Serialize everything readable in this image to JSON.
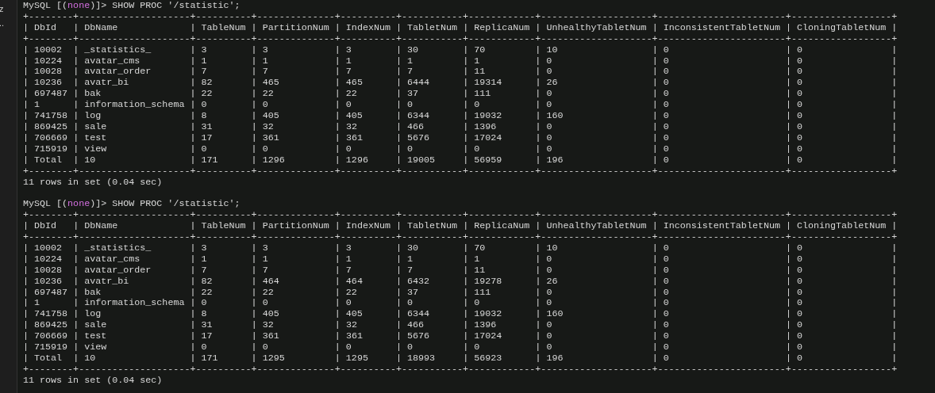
{
  "sidebar": {
    "items": [
      "z",
      ".."
    ]
  },
  "frame": {
    "bar": "|"
  },
  "blocks": [
    {
      "prompt": {
        "before": "MySQL [(",
        "database": "none",
        "after": ")]> SHOW PROC '/statistic';"
      },
      "columns": [
        "DbId",
        "DbName",
        "TableNum",
        "PartitionNum",
        "IndexNum",
        "TabletNum",
        "ReplicaNum",
        "UnhealthyTabletNum",
        "InconsistentTabletNum",
        "CloningTabletNum"
      ],
      "rows": [
        [
          "10002",
          "_statistics_",
          "3",
          "3",
          "3",
          "30",
          "70",
          "10",
          "0",
          "0"
        ],
        [
          "10224",
          "avatar_cms",
          "1",
          "1",
          "1",
          "1",
          "1",
          "0",
          "0",
          "0"
        ],
        [
          "10028",
          "avatar_order",
          "7",
          "7",
          "7",
          "7",
          "11",
          "0",
          "0",
          "0"
        ],
        [
          "10236",
          "avatr_bi",
          "82",
          "465",
          "465",
          "6444",
          "19314",
          "26",
          "0",
          "0"
        ],
        [
          "697487",
          "bak",
          "22",
          "22",
          "22",
          "37",
          "111",
          "0",
          "0",
          "0"
        ],
        [
          "1",
          "information_schema",
          "0",
          "0",
          "0",
          "0",
          "0",
          "0",
          "0",
          "0"
        ],
        [
          "741758",
          "log",
          "8",
          "405",
          "405",
          "6344",
          "19032",
          "160",
          "0",
          "0"
        ],
        [
          "869425",
          "sale",
          "31",
          "32",
          "32",
          "466",
          "1396",
          "0",
          "0",
          "0"
        ],
        [
          "706669",
          "test",
          "17",
          "361",
          "361",
          "5676",
          "17024",
          "0",
          "0",
          "0"
        ],
        [
          "715919",
          "view",
          "0",
          "0",
          "0",
          "0",
          "0",
          "0",
          "0",
          "0"
        ],
        [
          "Total",
          "10",
          "171",
          "1296",
          "1296",
          "19005",
          "56959",
          "196",
          "0",
          "0"
        ]
      ],
      "border": "+--------+--------------------+----------+--------------+----------+-----------+------------+--------------------+-----------------------+------------------+",
      "summary": "11 rows in set (0.04 sec)"
    },
    {
      "prompt": {
        "before": "MySQL [(",
        "database": "none",
        "after": ")]> SHOW PROC '/statistic';"
      },
      "columns": [
        "DbId",
        "DbName",
        "TableNum",
        "PartitionNum",
        "IndexNum",
        "TabletNum",
        "ReplicaNum",
        "UnhealthyTabletNum",
        "InconsistentTabletNum",
        "CloningTabletNum"
      ],
      "rows": [
        [
          "10002",
          "_statistics_",
          "3",
          "3",
          "3",
          "30",
          "70",
          "10",
          "0",
          "0"
        ],
        [
          "10224",
          "avatar_cms",
          "1",
          "1",
          "1",
          "1",
          "1",
          "0",
          "0",
          "0"
        ],
        [
          "10028",
          "avatar_order",
          "7",
          "7",
          "7",
          "7",
          "11",
          "0",
          "0",
          "0"
        ],
        [
          "10236",
          "avatr_bi",
          "82",
          "464",
          "464",
          "6432",
          "19278",
          "26",
          "0",
          "0"
        ],
        [
          "697487",
          "bak",
          "22",
          "22",
          "22",
          "37",
          "111",
          "0",
          "0",
          "0"
        ],
        [
          "1",
          "information_schema",
          "0",
          "0",
          "0",
          "0",
          "0",
          "0",
          "0",
          "0"
        ],
        [
          "741758",
          "log",
          "8",
          "405",
          "405",
          "6344",
          "19032",
          "160",
          "0",
          "0"
        ],
        [
          "869425",
          "sale",
          "31",
          "32",
          "32",
          "466",
          "1396",
          "0",
          "0",
          "0"
        ],
        [
          "706669",
          "test",
          "17",
          "361",
          "361",
          "5676",
          "17024",
          "0",
          "0",
          "0"
        ],
        [
          "715919",
          "view",
          "0",
          "0",
          "0",
          "0",
          "0",
          "0",
          "0",
          "0"
        ],
        [
          "Total",
          "10",
          "171",
          "1295",
          "1295",
          "18993",
          "56923",
          "196",
          "0",
          "0"
        ]
      ],
      "border": "+--------+--------------------+----------+--------------+----------+-----------+------------+--------------------+-----------------------+------------------+",
      "summary": "11 rows in set (0.04 sec)"
    }
  ]
}
